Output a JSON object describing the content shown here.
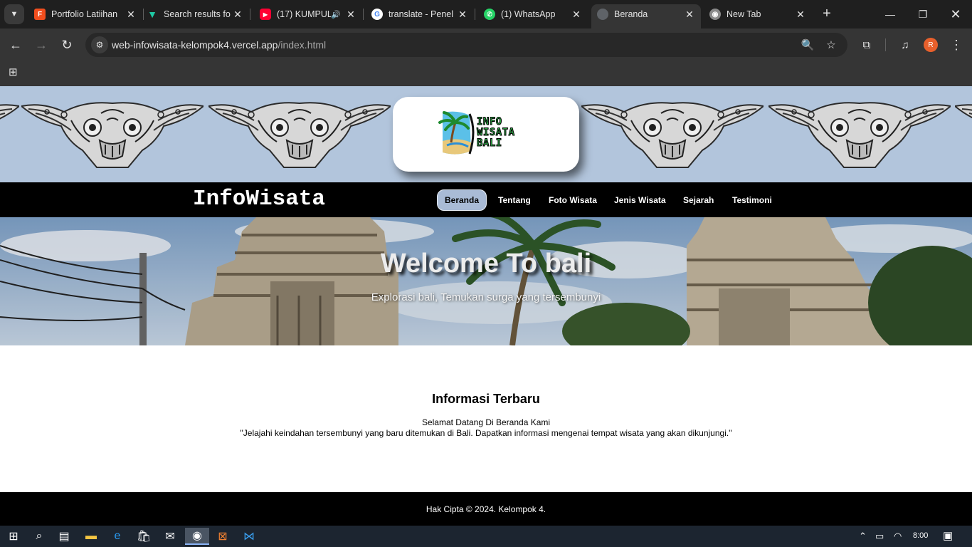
{
  "browser": {
    "tabs": [
      {
        "title": "Portfolio Latiihan",
        "favicon": "figma-icon",
        "color": "#f24e1e"
      },
      {
        "title": "Search results fo",
        "favicon": "vuetify-icon",
        "color": "#1ec9a4"
      },
      {
        "title": "(17) KUMPUL",
        "favicon": "youtube-icon",
        "color": "#ff0033"
      },
      {
        "title": "translate - Penel",
        "favicon": "google-icon",
        "color": "#4285f4"
      },
      {
        "title": "(1) WhatsApp",
        "favicon": "whatsapp-icon",
        "color": "#25d366"
      },
      {
        "title": "Beranda",
        "favicon": "globe-icon",
        "color": "#5f6368",
        "active": true
      },
      {
        "title": "New Tab",
        "favicon": "chrome-icon",
        "color": "#a0a0a0"
      }
    ],
    "url_host": "web-infowisata-kelompok4.vercel.app",
    "url_path": "/index.html",
    "profile_initial": "R"
  },
  "site": {
    "logo_lines": [
      "INFO",
      "WISATA",
      "BALI"
    ],
    "brand": "InfoWisata",
    "nav": [
      "Beranda",
      "Tentang",
      "Foto Wisata",
      "Jenis Wisata",
      "Sejarah",
      "Testimoni"
    ],
    "active_nav": "Beranda",
    "hero_title": "Welcome To bali",
    "hero_subtitle": "Explorasi bali, Temukan surga yang tersembunyi",
    "info_title": "Informasi Terbaru",
    "info_line1": "Selamat Datang Di Beranda Kami",
    "info_line2": "\"Jelajahi keindahan tersembunyi yang baru ditemukan di Bali. Dapatkan informasi mengenai tempat wisata yang akan dikunjungi.\"",
    "footer": "Hak Cipta © 2024. Kelompok 4.",
    "colors": {
      "banner_bg": "#b2c5dc",
      "nav_active": "#a9bbd6",
      "logo_green": "#2fb34a"
    }
  },
  "taskbar": {
    "time": "8:00",
    "apps": [
      "windows-start-icon",
      "search-icon",
      "task-view-icon",
      "file-explorer-icon",
      "edge-icon",
      "store-icon",
      "mail-icon",
      "chrome-icon",
      "xampp-icon",
      "vscode-icon"
    ]
  }
}
